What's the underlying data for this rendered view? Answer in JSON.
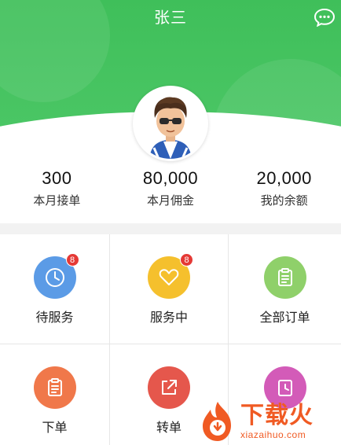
{
  "header": {
    "title": "张三",
    "chat_icon": "chat-bubble-icon",
    "background_color": "#43c15e"
  },
  "profile": {
    "avatar_icon": "cartoon-avatar"
  },
  "stats": [
    {
      "value": "300",
      "label": "本月接单"
    },
    {
      "value": "80,000",
      "label": "本月佣金"
    },
    {
      "value": "20,000",
      "label": "我的余额"
    }
  ],
  "grid": [
    {
      "label": "待服务",
      "icon": "clock-icon",
      "color": "#5b9be6",
      "badge": "8"
    },
    {
      "label": "服务中",
      "icon": "heart-icon",
      "color": "#f5c02d",
      "badge": "8"
    },
    {
      "label": "全部订单",
      "icon": "clipboard-icon",
      "color": "#8fd06a",
      "badge": ""
    },
    {
      "label": "下单",
      "icon": "clipboard-icon",
      "color": "#f0784a",
      "badge": ""
    },
    {
      "label": "转单",
      "icon": "share-icon",
      "color": "#e5574c",
      "badge": ""
    },
    {
      "label": "",
      "icon": "clock-icon",
      "color": "#d35bb8",
      "badge": ""
    }
  ],
  "watermark": {
    "main": "下载火",
    "sub": "xiazaihuo.com",
    "color": "#f05a23"
  }
}
